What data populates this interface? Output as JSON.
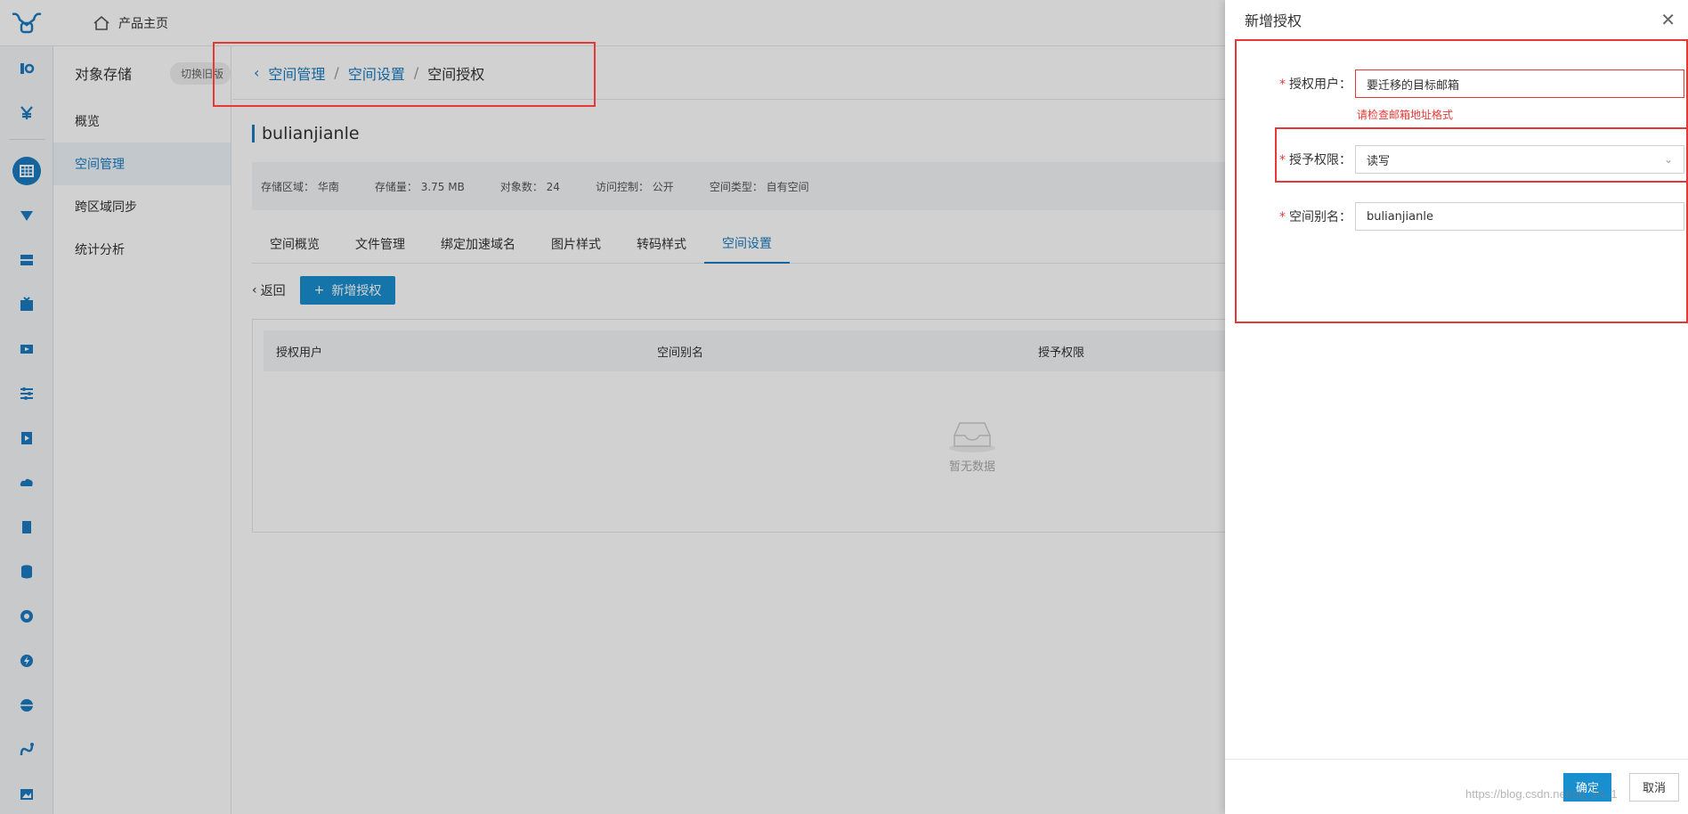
{
  "topbar": {
    "home_label": "产品主页"
  },
  "sidenav": {
    "title": "对象存储",
    "switch_label": "切换旧版",
    "items": [
      {
        "label": "概览"
      },
      {
        "label": "空间管理"
      },
      {
        "label": "跨区域同步"
      },
      {
        "label": "统计分析"
      }
    ]
  },
  "breadcrumb": {
    "item1": "空间管理",
    "sep": "/",
    "item2": "空间设置",
    "item3": "空间授权"
  },
  "bucket": {
    "name": "bulianjianle"
  },
  "stats": [
    {
      "label": "存储区域：",
      "value": "华南"
    },
    {
      "label": "存储量：",
      "value": "3.75 MB"
    },
    {
      "label": "对象数：",
      "value": "24"
    },
    {
      "label": "访问控制：",
      "value": "公开"
    },
    {
      "label": "空间类型：",
      "value": "自有空间"
    }
  ],
  "tabs": [
    "空间概览",
    "文件管理",
    "绑定加速域名",
    "图片样式",
    "转码样式",
    "空间设置"
  ],
  "actions": {
    "back_label": "返回",
    "add_label": "新增授权"
  },
  "table": {
    "columns": [
      "授权用户",
      "空间别名",
      "授予权限"
    ],
    "empty_text": "暂无数据"
  },
  "drawer": {
    "title": "新增授权",
    "user_label": "授权用户：",
    "user_value": "要迁移的目标邮箱",
    "user_error": "请检查邮箱地址格式",
    "perm_label": "授予权限：",
    "perm_value": "读写",
    "alias_label": "空间别名：",
    "alias_value": "bulianjianle",
    "ok_label": "确定",
    "cancel_label": "取消"
  },
  "watermark": "https://blog.csdn.net/qq_24..1",
  "colors": {
    "accent": "#1a8fd0",
    "error": "#e53935"
  }
}
